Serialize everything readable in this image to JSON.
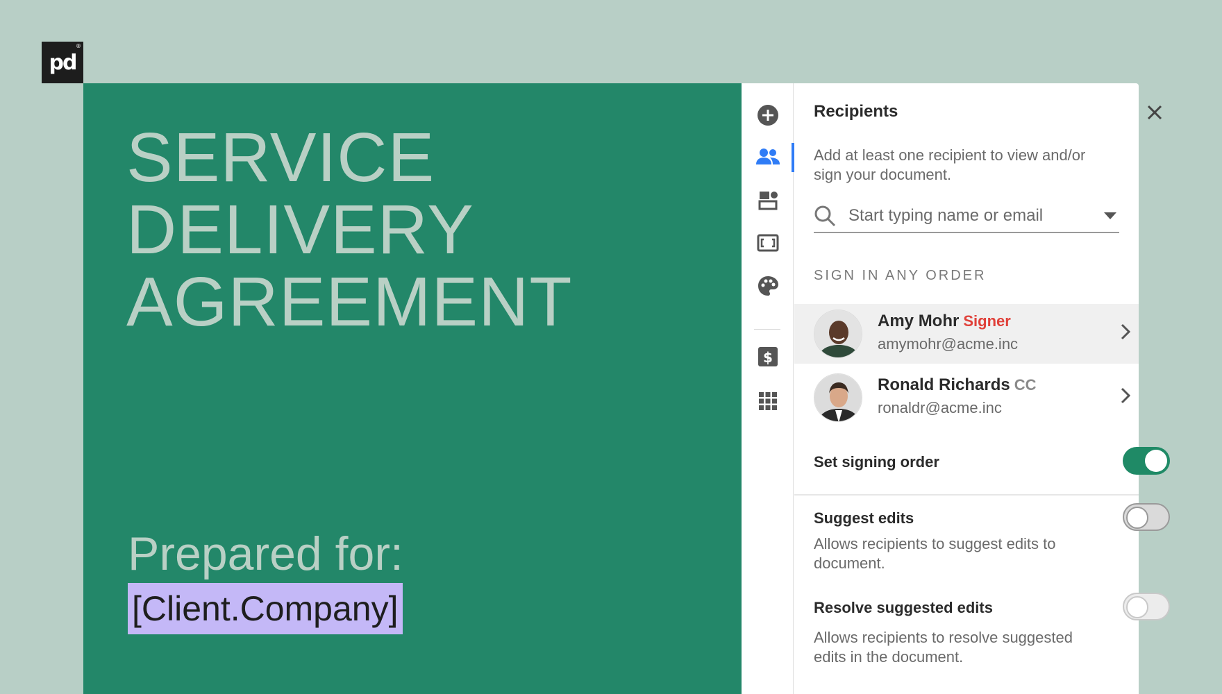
{
  "brand": {
    "logo_text": "pd",
    "logo_mark": "®"
  },
  "document": {
    "title_lines": [
      "SERVICE",
      "DELIVERY",
      "AGREEMENT"
    ],
    "prepared_for": "Prepared for:",
    "client_token": "[Client.Company]"
  },
  "sidebar": {
    "icons": [
      "add-icon",
      "recipients-icon",
      "blocks-icon",
      "fields-icon",
      "palette-icon",
      "pricing-icon",
      "apps-icon"
    ],
    "active": "recipients-icon"
  },
  "recipients_panel": {
    "title": "Recipients",
    "description": "Add at least one recipient to view and/or sign your document.",
    "search_placeholder": "Start typing name or email",
    "order_heading": "SIGN IN ANY ORDER",
    "recipients": [
      {
        "name": "Amy Mohr",
        "role": "Signer",
        "email": "amymohr@acme.inc",
        "role_color": "#e0413a"
      },
      {
        "name": "Ronald Richards",
        "role": "CC",
        "email": "ronaldr@acme.inc",
        "role_color": "#8a8a8a"
      }
    ],
    "signing_order": {
      "label": "Set signing order",
      "enabled": true
    },
    "suggest_edits": {
      "label": "Suggest edits",
      "description": "Allows recipients to suggest edits to document.",
      "enabled": false
    },
    "resolve_edits": {
      "label": "Resolve suggested edits",
      "description": "Allows recipients to resolve suggested edits in the document.",
      "enabled": false
    }
  },
  "colors": {
    "accent": "#238769",
    "toggle_on": "#1f8a66",
    "active_tab": "#2f7cf6",
    "highlight": "#c4b8f7",
    "background": "#b8cfc6"
  }
}
